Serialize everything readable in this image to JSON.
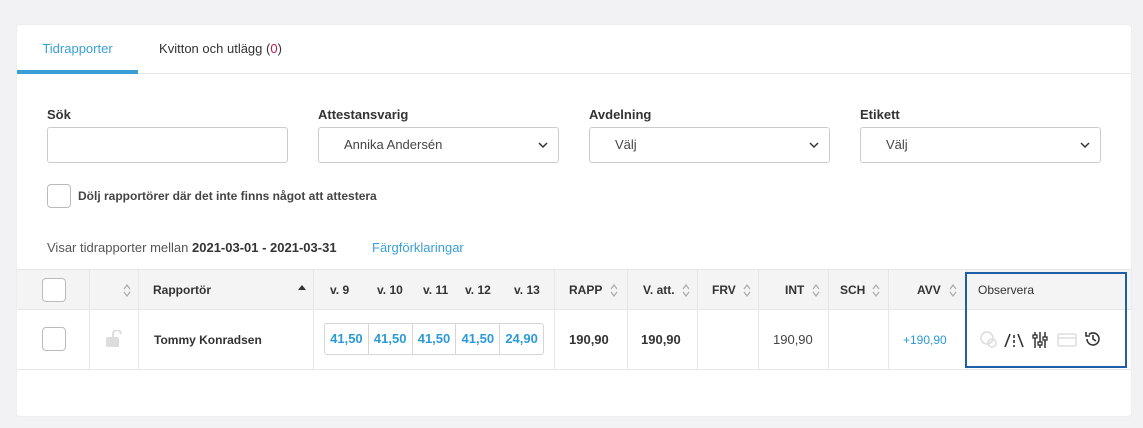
{
  "tabs": [
    {
      "label": "Tidrapporter"
    },
    {
      "label": "Kvitton och utlägg",
      "count_open": " (",
      "count": "0",
      "count_close": ")"
    }
  ],
  "filters": {
    "search_label": "Sök",
    "search_value": "",
    "attest_label": "Attestansvarig",
    "attest_value": "Annika Andersén",
    "dept_label": "Avdelning",
    "dept_value": "Välj",
    "tag_label": "Etikett",
    "tag_value": "Välj"
  },
  "hide_checkbox_label": "Dölj rapportörer där det inte finns något att attestera",
  "range": {
    "prefix": "Visar tidrapporter mellan ",
    "dates": "2021-03-01 - 2021-03-31",
    "legend_link": "Färgförklaringar"
  },
  "table": {
    "headers": {
      "reporter": "Rapportör",
      "w9": "v. 9",
      "w10": "v. 10",
      "w11": "v. 11",
      "w12": "v. 12",
      "w13": "v. 13",
      "rapp": "RAPP",
      "vatt": "V. att.",
      "frv": "FRV",
      "int": "INT",
      "sch": "SCH",
      "avv": "AVV",
      "observe": "Observera"
    },
    "rows": [
      {
        "reporter": "Tommy Konradsen",
        "weeks": [
          "41,50",
          "41,50",
          "41,50",
          "41,50",
          "24,90"
        ],
        "rapp": "190,90",
        "vatt": "190,90",
        "frv": "",
        "int": "190,90",
        "sch": "",
        "avv": "+190,90"
      }
    ]
  },
  "colors": {
    "accent": "#3a9fd6",
    "count": "#c2185b",
    "highlight_border": "#1f5fa8"
  }
}
